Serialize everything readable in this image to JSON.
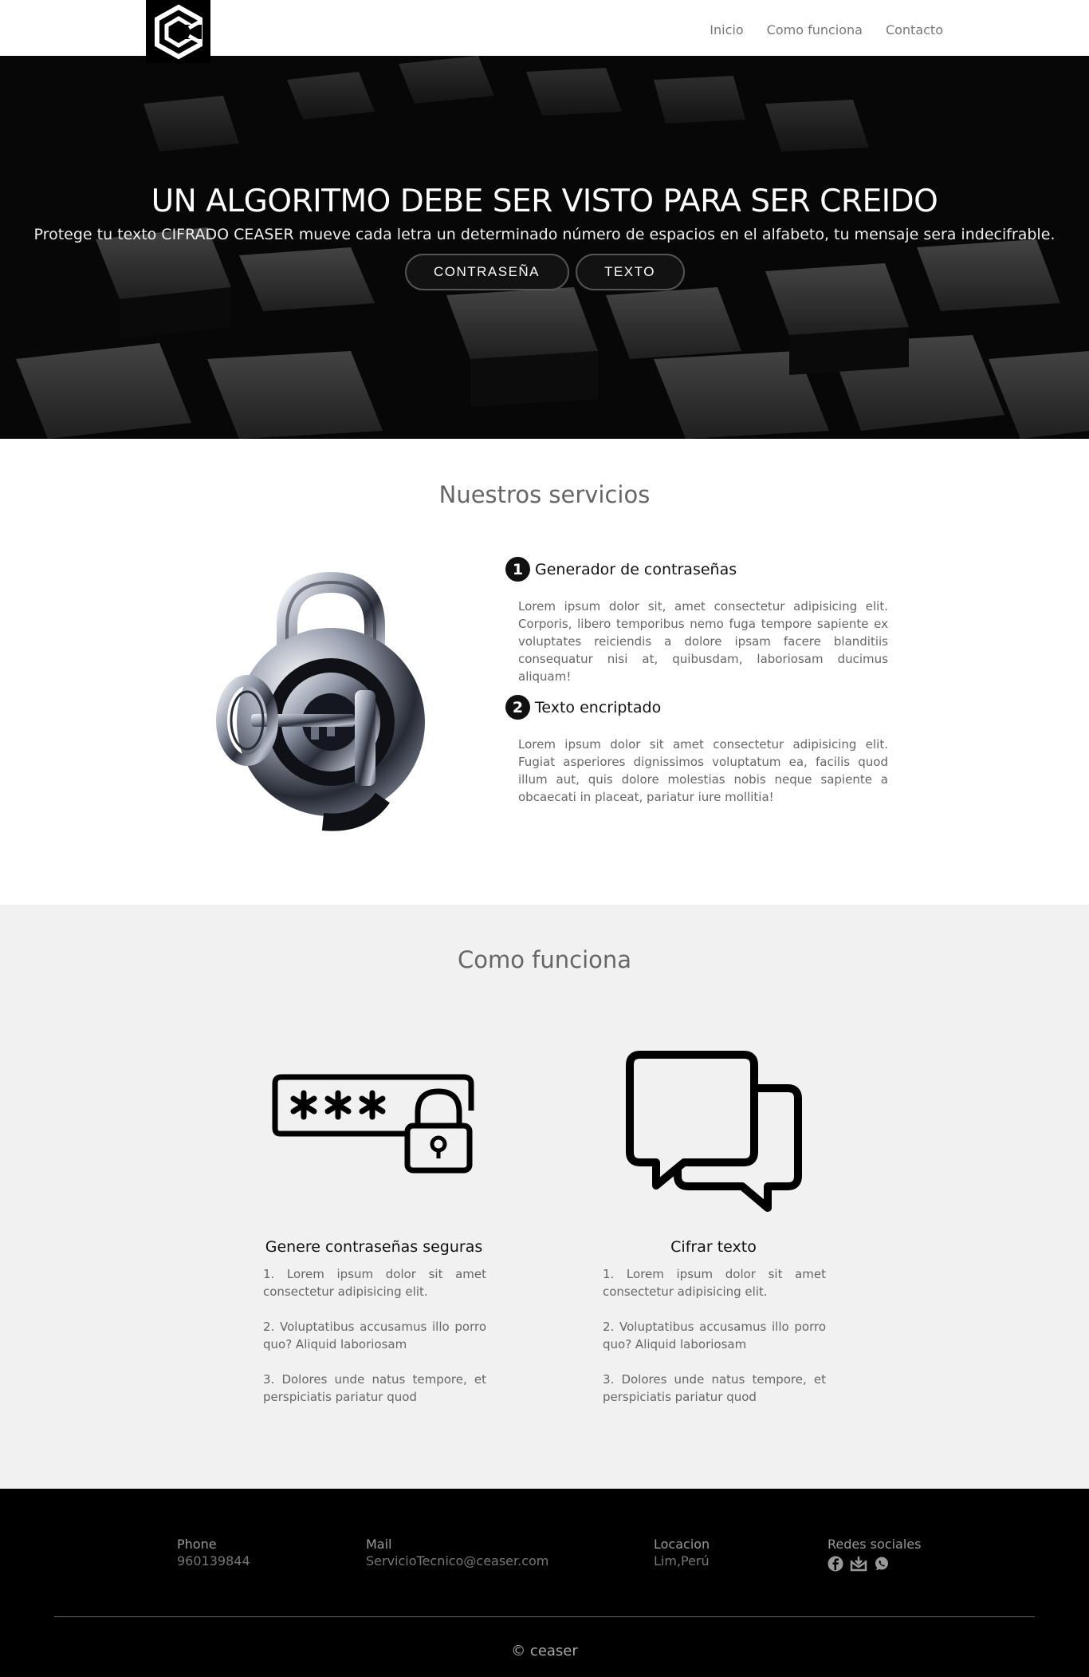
{
  "nav": {
    "logo_alt": "C",
    "links": [
      "Inicio",
      "Como funciona",
      "Contacto"
    ]
  },
  "hero": {
    "title": "UN ALGORITMO DEBE SER VISTO PARA SER CREIDO",
    "subtitle": "Protege tu texto CIFRADO CEASER mueve cada letra un determinado número de espacios en el alfabeto, tu mensaje sera indecifrable.",
    "btn_password": "CONTRASEÑA",
    "btn_text": "TEXTO"
  },
  "services": {
    "title": "Nuestros servicios",
    "items": [
      {
        "num": "1",
        "name": "Generador de contraseñas",
        "text": "Lorem ipsum dolor sit, amet consectetur adipisicing elit. Corporis, libero temporibus nemo fuga tempore sapiente ex voluptates reiciendis a dolore ipsam facere blanditiis consequatur nisi at, quibusdam, laboriosam ducimus aliquam!"
      },
      {
        "num": "2",
        "name": "Texto encriptado",
        "text": "Lorem ipsum dolor sit amet consectetur adipisicing elit. Fugiat asperiores dignissimos voluptatum ea, facilis quod illum aut, quis dolore molestias nobis neque sapiente a obcaecati in placeat, pariatur iure mollitia!"
      }
    ]
  },
  "how": {
    "title": "Como funciona",
    "cols": [
      {
        "title": "Genere contraseñas seguras",
        "icon": "password-lock-icon",
        "steps": [
          "1. Lorem ipsum dolor sit amet consectetur adipisicing elit.",
          "2. Voluptatibus accusamus illo porro quo? Aliquid laboriosam",
          "3. Dolores unde natus tempore, et perspiciatis pariatur quod"
        ]
      },
      {
        "title": "Cifrar texto",
        "icon": "chat-bubbles-icon",
        "steps": [
          "1. Lorem ipsum dolor sit amet consectetur adipisicing elit.",
          "2. Voluptatibus accusamus illo porro quo? Aliquid laboriosam",
          "3. Dolores unde natus tempore, et perspiciatis pariatur quod"
        ]
      }
    ]
  },
  "footer": {
    "phone_label": "Phone",
    "phone": "960139844",
    "mail_label": "Mail",
    "mail": "ServicioTecnico@ceaser.com",
    "location_label": "Locacion",
    "location": "Lim,Perú",
    "social_label": "Redes sociales",
    "social_icons": [
      "facebook-icon",
      "mail-icon",
      "whatsapp-icon"
    ],
    "copyright": "© ceaser"
  }
}
